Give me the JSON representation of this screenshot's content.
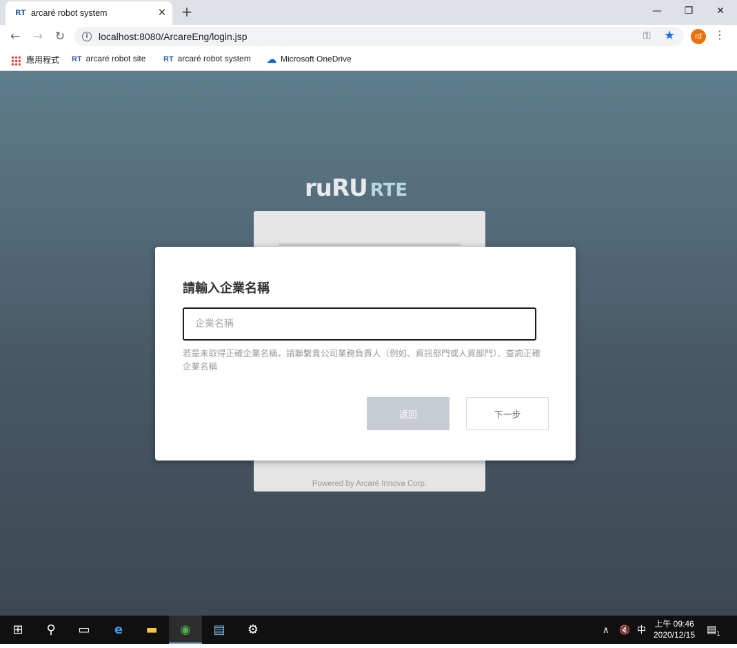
{
  "browser": {
    "tab_favicon": "RT",
    "tab_title": "arcaré robot system",
    "url": "localhost:8080/ArcareEng/login.jsp",
    "profile_initials": "rd",
    "bookmarks": [
      {
        "label": "應用程式",
        "icon": "apps-grid-icon"
      },
      {
        "label": "arcaré robot site",
        "icon": "rt-icon"
      },
      {
        "label": "arcaré robot system",
        "icon": "rt-icon"
      },
      {
        "label": "Microsoft OneDrive",
        "icon": "onedrive-icon"
      }
    ]
  },
  "page": {
    "logo_part1": "ruRU",
    "logo_part2": "RTE",
    "powered_by": "Powered by Arcaré Innova Corp."
  },
  "dialog": {
    "title": "請輸入企業名稱",
    "input_placeholder": "企業名稱",
    "input_value": "",
    "hint": "若是未取得正確企業名稱，請聯繫貴公司業務負責人（例如、資訊部門或人資部門）、查詢正確企業名稱",
    "back_label": "返回",
    "next_label": "下一步"
  },
  "taskbar": {
    "time_period": "上午 09:46",
    "date": "2020/12/15",
    "ime": "中",
    "notification_count": "1"
  }
}
